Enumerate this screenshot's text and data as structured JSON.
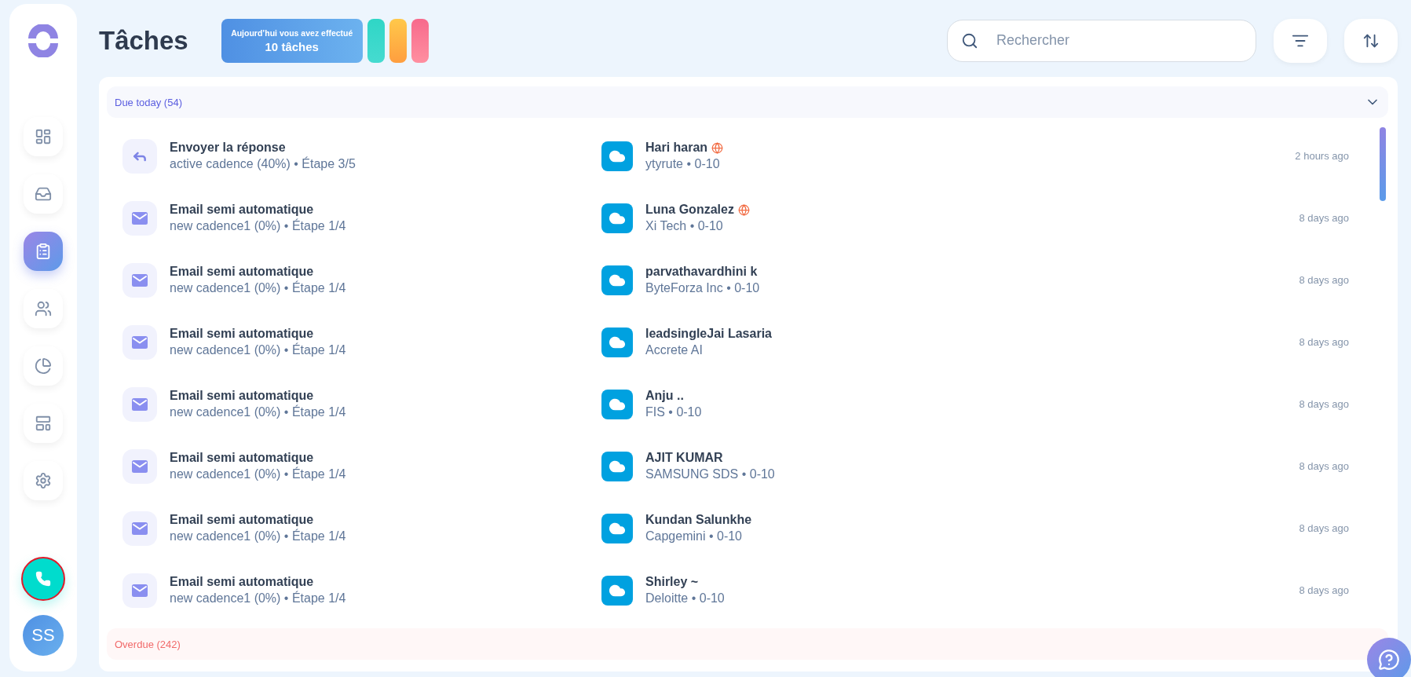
{
  "sidebar": {
    "items": [
      {
        "selected": false
      },
      {
        "selected": false
      },
      {
        "selected": true
      },
      {
        "selected": false
      },
      {
        "selected": false
      },
      {
        "selected": false
      },
      {
        "selected": false
      }
    ],
    "avatar": "SS"
  },
  "header": {
    "title": "Tâches",
    "summary": {
      "line_1": "Aujourd’hui vous avez effectué",
      "line_2": "10 tâches"
    },
    "search": {
      "placeholder": "Rechercher"
    }
  },
  "sections": [
    {
      "label": "Due today (54)",
      "kind": "due",
      "expanded": true,
      "rows": [
        {
          "kind": "reply",
          "title": "Envoyer la réponse",
          "subtitle": "active cadence (40%) • Étape 3/5",
          "contact": "Hari haran",
          "timezone_warning": true,
          "company": "ytyrute • 0-10",
          "time": "2 hours ago"
        },
        {
          "kind": "email",
          "title": "Email semi automatique",
          "subtitle": "new cadence1 (0%) • Étape 1/4",
          "contact": "Luna Gonzalez",
          "timezone_warning": true,
          "company": "Xi Tech • 0-10",
          "time": "8 days ago"
        },
        {
          "kind": "email",
          "title": "Email semi automatique",
          "subtitle": "new cadence1 (0%) • Étape 1/4",
          "contact": "parvathavardhini k",
          "timezone_warning": false,
          "company": "ByteForza Inc • 0-10",
          "time": "8 days ago"
        },
        {
          "kind": "email",
          "title": "Email semi automatique",
          "subtitle": "new cadence1 (0%) • Étape 1/4",
          "contact": "leadsingleJai Lasaria",
          "timezone_warning": false,
          "company": "Accrete AI",
          "time": "8 days ago"
        },
        {
          "kind": "email",
          "title": "Email semi automatique",
          "subtitle": "new cadence1 (0%) • Étape 1/4",
          "contact": "Anju ..",
          "timezone_warning": false,
          "company": "FIS • 0-10",
          "time": "8 days ago"
        },
        {
          "kind": "email",
          "title": "Email semi automatique",
          "subtitle": "new cadence1 (0%) • Étape 1/4",
          "contact": "AJIT KUMAR",
          "timezone_warning": false,
          "company": "SAMSUNG SDS • 0-10",
          "time": "8 days ago"
        },
        {
          "kind": "email",
          "title": "Email semi automatique",
          "subtitle": "new cadence1 (0%) • Étape 1/4",
          "contact": "Kundan Salunkhe",
          "timezone_warning": false,
          "company": "Capgemini • 0-10",
          "time": "8 days ago"
        },
        {
          "kind": "email",
          "title": "Email semi automatique",
          "subtitle": "new cadence1 (0%) • Étape 1/4",
          "contact": "Shirley ~",
          "timezone_warning": false,
          "company": "Deloitte • 0-10",
          "time": "8 days ago"
        }
      ]
    },
    {
      "label": "Overdue (242)",
      "kind": "overdue",
      "expanded": false
    }
  ]
}
